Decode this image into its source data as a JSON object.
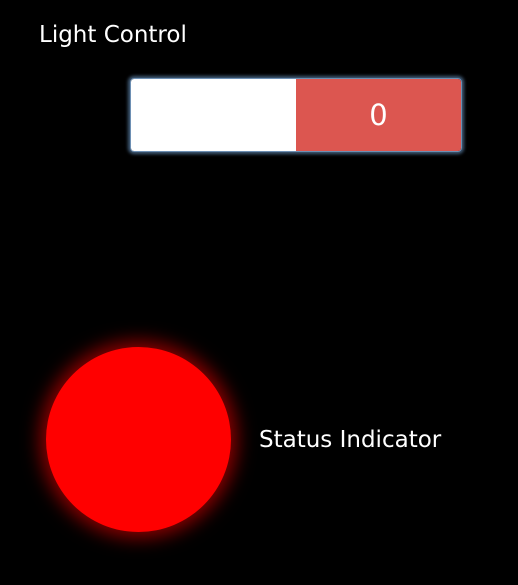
{
  "header": {
    "title": "Light Control"
  },
  "toggle": {
    "value_label": "0",
    "state": "off",
    "on_color": "#ffffff",
    "off_color": "#dc5650"
  },
  "status": {
    "label": "Status Indicator",
    "indicator_color": "#ff0000"
  }
}
